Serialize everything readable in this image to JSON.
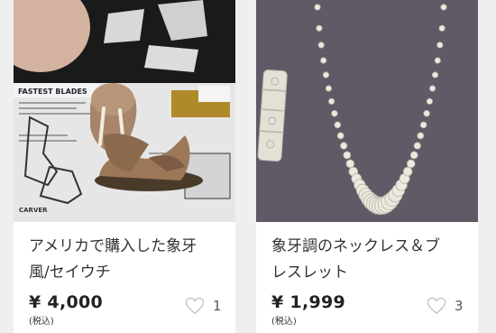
{
  "items": [
    {
      "title_line1": "アメリカで購入した象牙",
      "title_line2": "風/セイウチ",
      "price": "¥ 4,000",
      "tax_label": "(税込)",
      "like_count": "1",
      "photo_text": [
        "FASTEST BLADES",
        "CARVER"
      ]
    },
    {
      "title_line1": "象牙調のネックレス＆ブ",
      "title_line2": "レスレット",
      "price": "¥ 1,999",
      "tax_label": "(税込)",
      "like_count": "3"
    }
  ],
  "colors": {
    "page_bg": "#efefef",
    "card_bg": "#ffffff",
    "heart": "#c8c8c8"
  }
}
